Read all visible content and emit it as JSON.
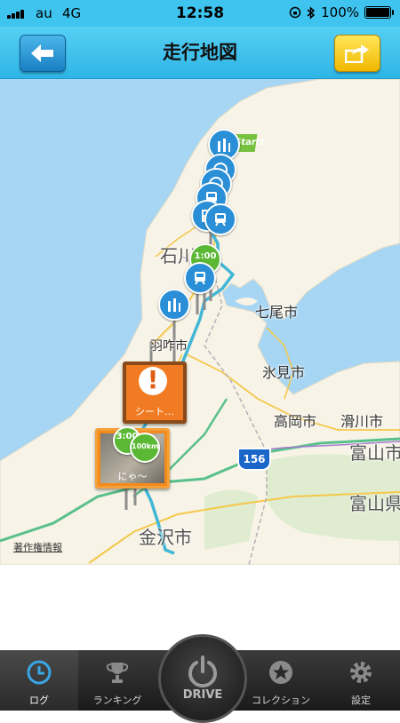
{
  "status_bar": {
    "carrier": "au",
    "network": "4G",
    "time": "12:58",
    "battery": "100%"
  },
  "header": {
    "title": "走行地図",
    "back_icon": "back-arrow-icon",
    "share_icon": "share-icon"
  },
  "map": {
    "labels": {
      "ishikawa": "石川県",
      "nanao": "七尾市",
      "hakui": "羽咋市",
      "himi": "氷見市",
      "takaoka": "高岡市",
      "namerikawa": "滑川市",
      "toyama_city": "富山市",
      "toyama_pref": "富山県",
      "kanazawa": "金沢市"
    },
    "route_number": "156",
    "attribution": "著作権情報",
    "start_flag": "Start!",
    "markers": {
      "time_marker": "1:00",
      "time_marker_2": "3:00",
      "distance_marker": "100km",
      "notice_caption": "シート…",
      "photo_caption": "にゃ〜"
    },
    "colors": {
      "sea": "#a6d6f4",
      "land": "#f7f3e6",
      "route": "#41b6d6",
      "pin": "#2a8fd6"
    }
  },
  "tabs": [
    {
      "label": "ログ",
      "icon": "clock-icon",
      "active": true
    },
    {
      "label": "ランキング",
      "icon": "trophy-icon",
      "active": false
    },
    {
      "label": "DRIVE",
      "icon": "power-icon",
      "active": false
    },
    {
      "label": "コレクション",
      "icon": "star-medal-icon",
      "active": false
    },
    {
      "label": "設定",
      "icon": "gear-icon",
      "active": false
    }
  ]
}
